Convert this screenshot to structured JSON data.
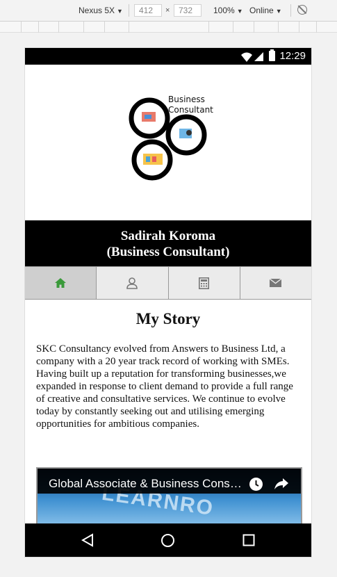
{
  "devtools": {
    "device": "Nexus 5X",
    "width": "412",
    "height": "732",
    "zoom": "100%",
    "network": "Online"
  },
  "status_bar": {
    "time": "12:29"
  },
  "logo": {
    "line1": "Business",
    "line2": "Consultant"
  },
  "header": {
    "name": "Sadirah Koroma",
    "role": "(Business Consultant)"
  },
  "tabs": [
    {
      "icon": "home-icon",
      "active": true
    },
    {
      "icon": "user-icon",
      "active": false
    },
    {
      "icon": "calculator-icon",
      "active": false
    },
    {
      "icon": "envelope-icon",
      "active": false
    }
  ],
  "story": {
    "heading": "My Story",
    "body": "SKC Consultancy evolved from Answers to Business Ltd, a company with a 20 year track record of working with SMEs. Having built up a reputation for transforming businesses,we expanded in response to client demand to provide a full range of creative and consultative services. We continue to evolve today by constantly seeking out and utilising emerging opportunities for ambitious companies."
  },
  "video": {
    "title": "Global Associate & Business Consultant",
    "background_text": "LEARNRO"
  },
  "colors": {
    "active_tab_icon": "#3a9a3a",
    "tab_icon": "#777777",
    "header_bg": "#000000"
  }
}
